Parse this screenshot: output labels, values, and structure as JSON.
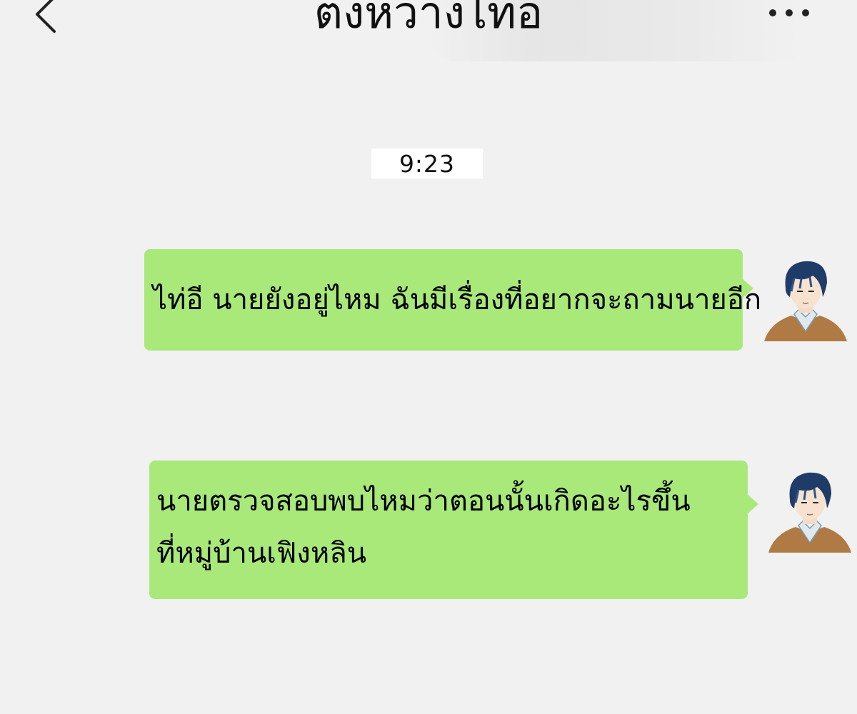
{
  "header": {
    "title": "ตงหวางไทอ",
    "back_icon": "chevron-left-icon",
    "more_icon": "ellipsis-icon"
  },
  "chat": {
    "timestamp": "9:23",
    "messages": [
      {
        "sender": "self",
        "lines": [
          "ไท่อี นายยังอยู่ไหม ฉันมีเรื่องที่อยากจะถามนายอีก"
        ]
      },
      {
        "sender": "self",
        "lines": [
          "นายตรวจสอบพบไหมว่าตอนนั้นเกิดอะไรขึ้น",
          "ที่หมู่บ้านเฟิงหลิน"
        ]
      }
    ]
  },
  "colors": {
    "background": "#f1f1f1",
    "bubble": "#a9e97a",
    "timestamp_bg": "#ffffff"
  }
}
